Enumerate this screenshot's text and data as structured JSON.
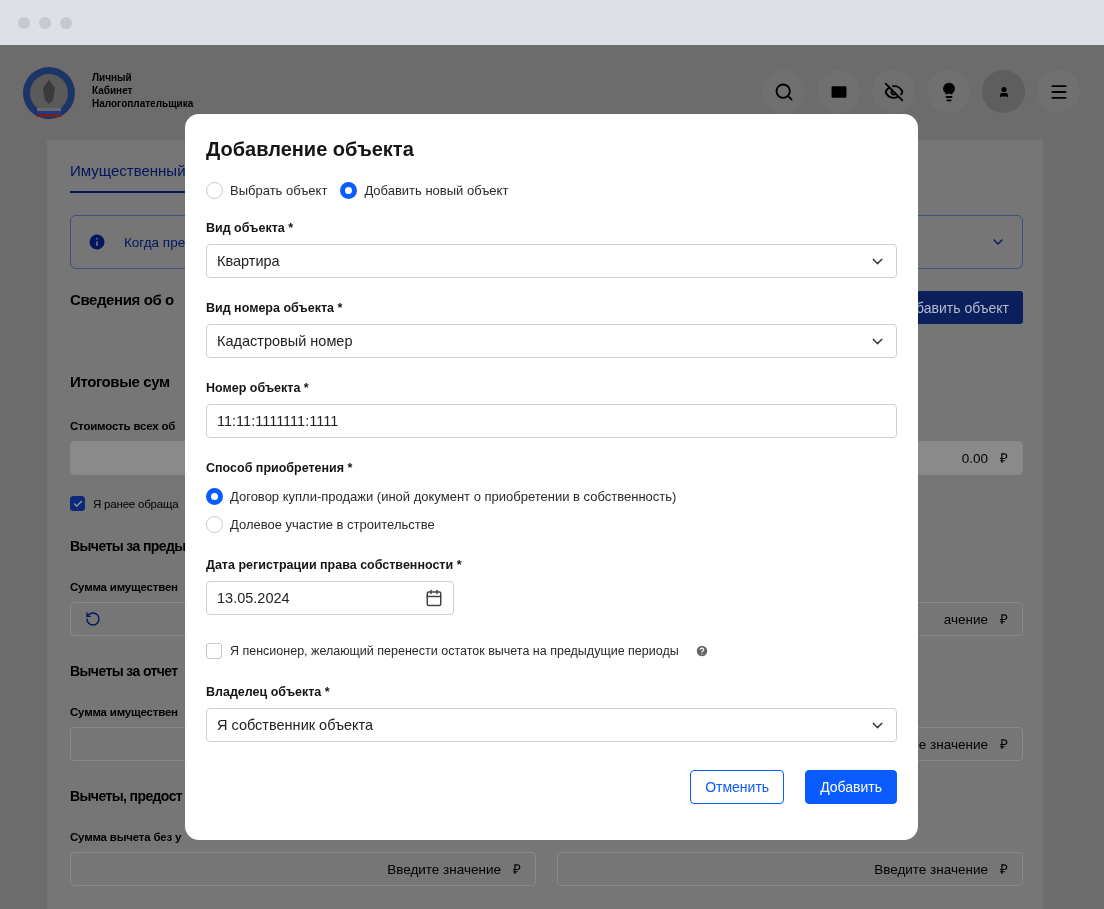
{
  "header": {
    "logo_lines": [
      "Личный",
      "Кабинет",
      "Налогоплательщика"
    ]
  },
  "page": {
    "tab": {
      "label": "Имущественный",
      "selected": true
    },
    "info_text": "Когда пре",
    "objects_title": "Сведения об о",
    "add_button": "бавить объект",
    "totals_title": "Итоговые сум",
    "cost_label": "Стоимость всех об",
    "cost_value": "0.00",
    "cost_currency": "₽",
    "previous_checkbox": {
      "label": "Я ранее обраща",
      "checked": true
    },
    "sections": [
      {
        "title": "Вычеты за преды",
        "label": "Сумма имуществен",
        "fields": [
          {
            "kind": "refresh"
          },
          {
            "kind": "amount",
            "placeholder": "ачение",
            "currency": "₽"
          }
        ]
      },
      {
        "title": "Вычеты за отчет",
        "label": "Сумма имуществен",
        "fields": [
          {
            "kind": "empty"
          },
          {
            "kind": "amount",
            "placeholder": "е значение",
            "currency": "₽"
          }
        ]
      },
      {
        "title": "Вычеты, предост",
        "label": "Сумма вычета без у",
        "fields": [
          {
            "kind": "amount",
            "placeholder": "Введите значение",
            "currency": "₽"
          },
          {
            "kind": "amount",
            "placeholder": "Введите значение",
            "currency": "₽"
          }
        ]
      }
    ]
  },
  "modal": {
    "title": "Добавление объекта",
    "mode_options": [
      {
        "label": "Выбрать объект",
        "selected": false
      },
      {
        "label": "Добавить новый объект",
        "selected": true
      }
    ],
    "fields": [
      {
        "kind": "select",
        "label": "Вид объекта *",
        "value": "Квартира"
      },
      {
        "kind": "select",
        "label": "Вид номера объекта *",
        "value": "Кадастровый номер"
      },
      {
        "kind": "input",
        "label": "Номер объекта *",
        "value": "11:11:1111111:1111"
      },
      {
        "kind": "radio",
        "label": "Способ приобретения *",
        "options": [
          {
            "label": "Договор купли-продажи (иной документ о приобретении в собственность)",
            "selected": true
          },
          {
            "label": "Долевое участие в строительстве",
            "selected": false
          }
        ]
      },
      {
        "kind": "date",
        "label": "Дата регистрации права собственности *",
        "value": "13.05.2024"
      },
      {
        "kind": "checkbox",
        "label": "Я пенсионер, желающий перенести остаток вычета на предыдущие периоды",
        "checked": false,
        "help": true
      },
      {
        "kind": "select",
        "label": "Владелец объекта *",
        "value": "Я собственник объекта"
      }
    ],
    "buttons": [
      {
        "kind": "secondary",
        "label": "Отменить"
      },
      {
        "kind": "primary",
        "label": "Добавить"
      }
    ]
  }
}
